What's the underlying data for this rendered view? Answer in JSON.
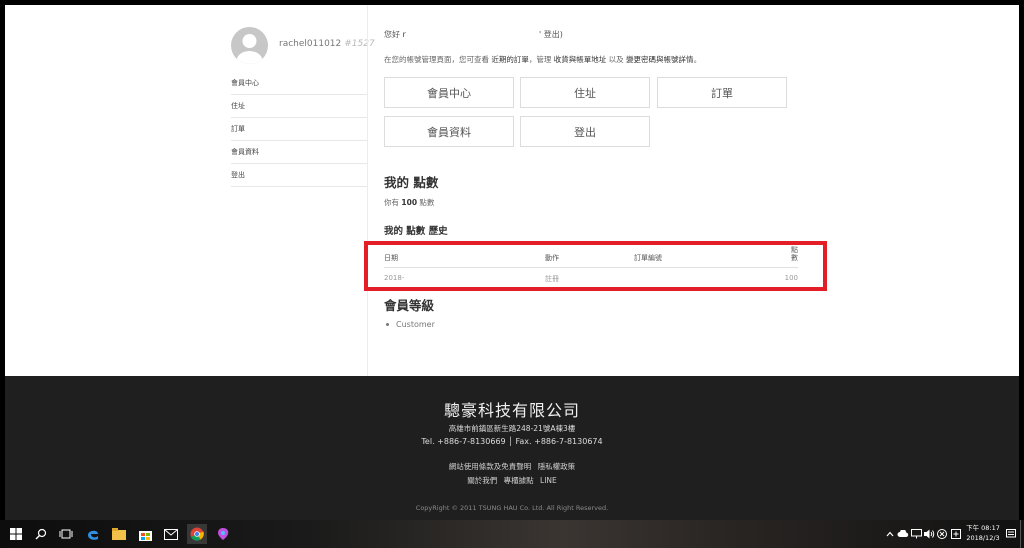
{
  "account": {
    "username": "rachel011012",
    "user_id": "#1527",
    "greeting_prefix": "您好 ",
    "greeting_name": "r",
    "logout_inline": "' 登出)",
    "intro": {
      "p1": "在您的帳號管理頁面，您可查看 ",
      "recent_orders": "近期的訂單",
      "p2": "，管理 ",
      "addresses": "收貨與帳單地址",
      "p3": " 以及 ",
      "edit_account": "變更密碼與帳號詳情",
      "p4": "。"
    }
  },
  "sidebar": {
    "items": [
      {
        "label": "會員中心"
      },
      {
        "label": "住址"
      },
      {
        "label": "訂單"
      },
      {
        "label": "會員資料"
      },
      {
        "label": "登出"
      }
    ]
  },
  "dashboard_buttons": [
    {
      "label": "會員中心"
    },
    {
      "label": "住址"
    },
    {
      "label": "訂單"
    },
    {
      "label": "會員資料"
    },
    {
      "label": "登出"
    }
  ],
  "points": {
    "heading": "我的 點數",
    "line_prefix": "你有 ",
    "amount": "100",
    "line_suffix": " 點數",
    "history_heading": "我的 點數 歷史",
    "columns": {
      "date": "日期",
      "action": "動作",
      "order": "訂單編號",
      "points": "點數"
    },
    "rows": [
      {
        "date": "2018-",
        "action": "註冊",
        "order": "",
        "points": "100"
      }
    ]
  },
  "level": {
    "heading": "會員等級",
    "items": [
      "Customer"
    ]
  },
  "footer": {
    "company": "驄豪科技有限公司",
    "address": "高雄市前鎮區新生路248-21號A棟3樓",
    "tel": "Tel. +886-7-8130669 │ Fax. +886-7-8130674",
    "links_row1": [
      "網站使用條款及免責聲明",
      "隱私權政策"
    ],
    "links_row2": [
      "關於我們",
      "專櫃據點",
      "LINE"
    ],
    "copyright": "CopyRight © 2011 TSUNG HAU Co. Ltd. All Right Reserved."
  },
  "taskbar": {
    "time": "下午 08:17",
    "date": "2018/12/3",
    "apps": [
      "windows-icon",
      "search-icon",
      "task-view-icon",
      "edge-icon",
      "file-explorer-icon",
      "store-icon",
      "mail-icon",
      "chrome-icon",
      "paint-icon"
    ]
  },
  "colors": {
    "highlight": "#e41e26",
    "footer_bg": "#1f1f1f",
    "avatar": "#c7c7c7"
  }
}
